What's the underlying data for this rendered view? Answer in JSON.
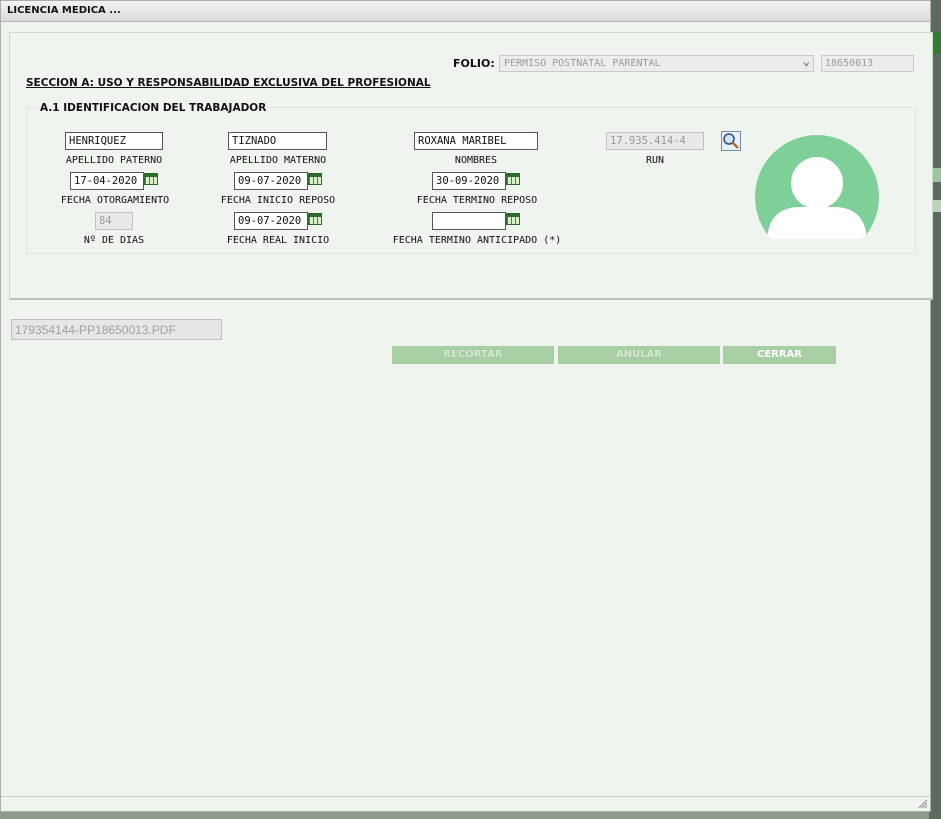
{
  "window": {
    "title": "LICENCIA MEDICA ..."
  },
  "folio": {
    "label": "FOLIO:",
    "type_selected": "PERMISO POSTNATAL PARENTAL",
    "number": "18650013"
  },
  "section": {
    "title": "SECCION A: USO Y RESPONSABILIDAD EXCLUSIVA DEL PROFESIONAL"
  },
  "identificacion": {
    "legend": "A.1 IDENTIFICACION DEL TRABAJADOR",
    "apellido_paterno": {
      "value": "HENRIQUEZ",
      "label": "APELLIDO PATERNO"
    },
    "apellido_materno": {
      "value": "TIZNADO",
      "label": "APELLIDO MATERNO"
    },
    "nombres": {
      "value": "ROXANA MARIBEL",
      "label": "NOMBRES"
    },
    "run": {
      "value": "17.935.414-4",
      "label": "RUN"
    },
    "fecha_otorgamiento": {
      "value": "17-04-2020",
      "label": "FECHA OTORGAMIENTO"
    },
    "fecha_inicio_reposo": {
      "value": "09-07-2020",
      "label": "FECHA INICIO REPOSO"
    },
    "fecha_termino_reposo": {
      "value": "30-09-2020",
      "label": "FECHA TERMINO REPOSO"
    },
    "dias": {
      "value": "84",
      "label": "Nº DE DIAS"
    },
    "fecha_real_inicio": {
      "value": "09-07-2020",
      "label": "FECHA REAL INICIO"
    },
    "fecha_termino_anticipado": {
      "value": "",
      "label": "FECHA TERMINO ANTICIPADO (*)"
    }
  },
  "attachment": {
    "filename": "179354144-PP18650013.PDF"
  },
  "buttons": {
    "recortar": "RECORTAR",
    "anular": "ANULAR",
    "cerrar": "CERRAR"
  },
  "colors": {
    "button_green": "#a7cfa3",
    "avatar_green": "#7fcf98",
    "panel_bg": "#eff4ee"
  }
}
